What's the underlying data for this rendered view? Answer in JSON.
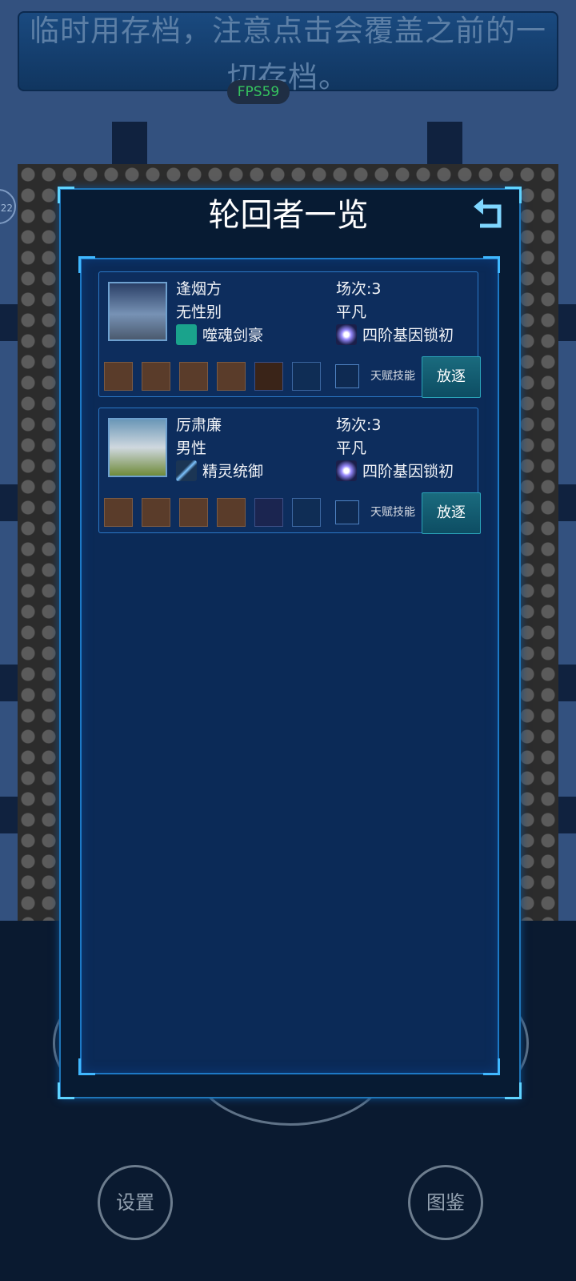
{
  "top_notice": "临时用存档，注意点击会覆盖之前的一切存档。",
  "fps": "FPS59",
  "side_badge": "22",
  "modal": {
    "title": "轮回者一览",
    "back_icon": "return-arrow-icon"
  },
  "characters": [
    {
      "name": "逢烟方",
      "gender": "无性别",
      "class_name": "噬魂剑豪",
      "class_icon": "ghost-icon",
      "rounds": "场次:3",
      "tier": "平凡",
      "gene_lock": "四阶基因锁初",
      "gene_icon": "starburst-icon",
      "talent_label": "天赋技能",
      "exile_label": "放逐",
      "equipment": [
        "crystal-shard-icon",
        "crystal-shard-icon",
        "crystal-shard-icon",
        "crystal-shard-icon",
        "scythe-icon",
        "empty"
      ]
    },
    {
      "name": "厉肃廉",
      "gender": "男性",
      "class_name": "精灵统御",
      "class_icon": "spear-icon",
      "rounds": "场次:3",
      "tier": "平凡",
      "gene_lock": "四阶基因锁初",
      "gene_icon": "starburst-icon",
      "talent_label": "天赋技能",
      "exile_label": "放逐",
      "equipment": [
        "green-blade-icon",
        "green-blade-icon",
        "green-blade-icon",
        "red-boots-icon",
        "purple-staff-icon",
        "empty"
      ]
    }
  ],
  "bottom_buttons": {
    "settings": "设置",
    "codex": "图鉴"
  }
}
